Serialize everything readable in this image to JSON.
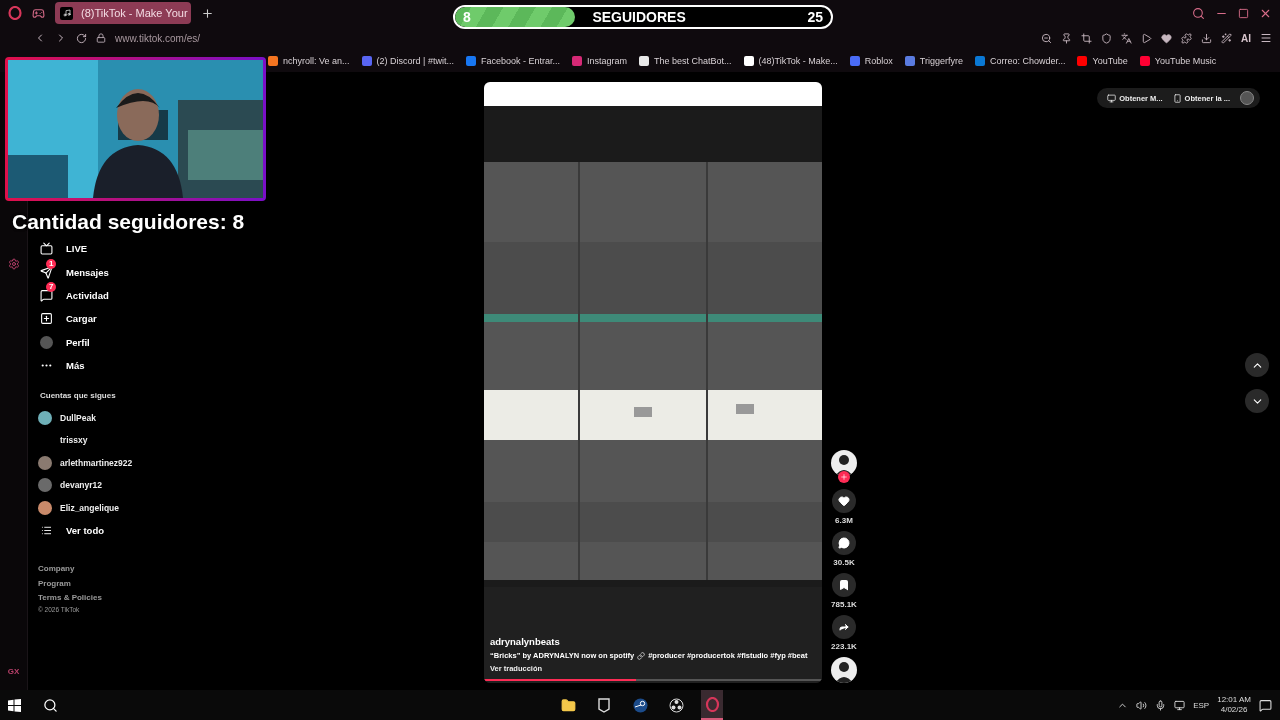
{
  "browser": {
    "tab": {
      "title": "(8)TikTok - Make Your",
      "selected": true
    },
    "url": "www.tiktok.com/es/",
    "ai_label": "AI"
  },
  "bookmarks": [
    {
      "label": "nchyroll: Ve an...",
      "color": "#f47521"
    },
    {
      "label": "(2) Discord | #twit...",
      "color": "#5865f2"
    },
    {
      "label": "Facebook - Entrar...",
      "color": "#1877f2"
    },
    {
      "label": "Instagram",
      "color": "#d62976"
    },
    {
      "label": "The best ChatBot...",
      "color": "#e8e8e8"
    },
    {
      "label": "(48)TikTok - Make...",
      "color": "#ffffff"
    },
    {
      "label": "Roblox",
      "color": "#4a6cf7"
    },
    {
      "label": "Triggerfyre",
      "color": "#5a7be0"
    },
    {
      "label": "Correo: Chowder...",
      "color": "#0a78d4"
    },
    {
      "label": "YouTube",
      "color": "#ff0000"
    },
    {
      "label": "YouTube Music",
      "color": "#ff0033"
    }
  ],
  "follower_goal": {
    "count": "8",
    "label": "SEGUIDORES",
    "goal": "25",
    "level": 0.32
  },
  "follower_overlay": "Cantidad seguidores: 8",
  "rail_label": "GX",
  "sidebar": {
    "nav": [
      {
        "kind": "live",
        "label": "LIVE"
      },
      {
        "kind": "messages",
        "label": "Mensajes",
        "badge": "1"
      },
      {
        "kind": "activity",
        "label": "Actividad",
        "badge": "7"
      },
      {
        "kind": "upload",
        "label": "Cargar"
      },
      {
        "kind": "profile",
        "label": "Perfil"
      },
      {
        "kind": "more",
        "label": "Más"
      }
    ],
    "following_title": "Cuentas que sigues",
    "following": [
      {
        "name": "DullPeak",
        "kind": "avatar",
        "color": "#6fb0b8"
      },
      {
        "name": "trissxy",
        "kind": "none"
      },
      {
        "name": "arlethmartinez922",
        "kind": "avatar",
        "color": "#8a7a70"
      },
      {
        "name": "devanyr12",
        "kind": "avatar",
        "color": "#6a6a6a"
      },
      {
        "name": "Eliz_angelique",
        "kind": "avatar",
        "color": "#c98a6a"
      }
    ],
    "see_all": "Ver todo",
    "footer": [
      "Company",
      "Program",
      "Terms & Policies",
      "© 2026 TikTok"
    ]
  },
  "video": {
    "author": "adrynalynbeats",
    "description": "“Bricks” by ADRYNALYN now on spotify",
    "hashtags": "#producer #producertok #flstudio #fyp #beat",
    "translate": "Ver traducción",
    "level": 0.45
  },
  "actions": [
    {
      "kind": "avatar"
    },
    {
      "kind": "like",
      "count": "6.3M"
    },
    {
      "kind": "comment",
      "count": "30.5K"
    },
    {
      "kind": "save",
      "count": "785.1K"
    },
    {
      "kind": "share",
      "count": "223.1K"
    },
    {
      "kind": "disc"
    }
  ],
  "top_actions": [
    {
      "kind": "desktop",
      "label": "Obtener M..."
    },
    {
      "kind": "phone",
      "label": "Obtener la ..."
    }
  ],
  "taskbar": {
    "language": "ESP",
    "time": "12:01 AM",
    "date": "4/02/26"
  }
}
